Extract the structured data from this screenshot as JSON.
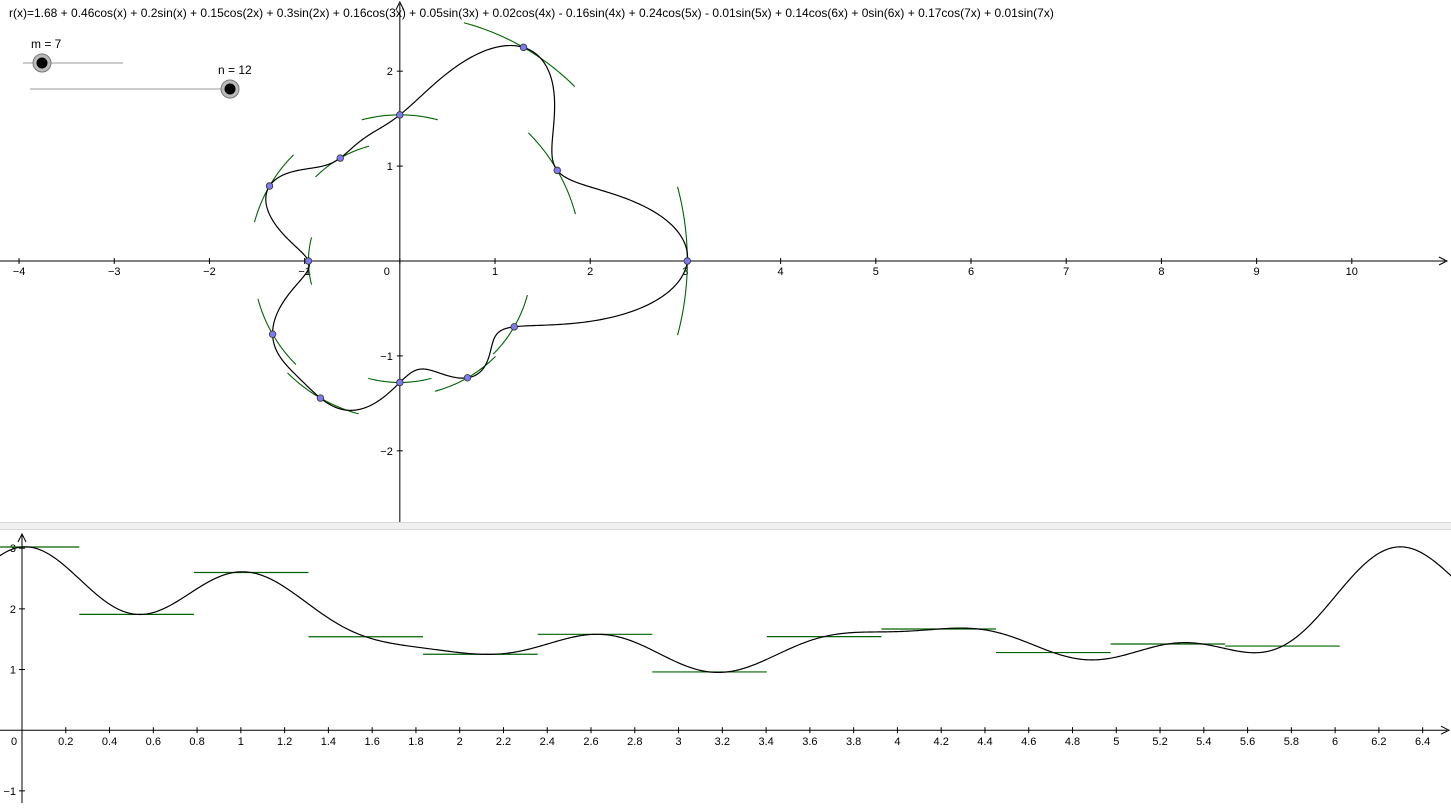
{
  "formula_text": "r(x)=1.68 + 0.46cos(x) + 0.2sin(x) + 0.15cos(2x) + 0.3sin(2x) + 0.16cos(3x) + 0.05sin(3x) + 0.02cos(4x) - 0.16sin(4x) + 0.24cos(5x) - 0.01sin(5x) + 0.14cos(6x) + 0sin(6x) + 0.17cos(7x) + 0.01sin(7x)",
  "coefficients": {
    "a0": 1.68,
    "cos": [
      0.46,
      0.15,
      0.16,
      0.02,
      0.24,
      0.14,
      0.17
    ],
    "sin": [
      0.2,
      0.3,
      0.05,
      -0.16,
      -0.01,
      0,
      0.01
    ]
  },
  "sliders": {
    "m": {
      "label": "m = 7",
      "value": 7,
      "min": 1,
      "max": 7
    },
    "n": {
      "label": "n = 12",
      "value": 12,
      "min": 1,
      "max": 12
    }
  },
  "colors": {
    "curve": "#000000",
    "segments": "#006400",
    "points": "#7c7cf0",
    "slider_knob": "#000000"
  },
  "chart_data": [
    {
      "type": "line",
      "title": "",
      "description_of_curve": "polar curve r(x)",
      "xlim": [
        -4.2,
        11
      ],
      "ylim": [
        -2.75,
        2.75
      ],
      "x_ticks": [
        "-4",
        "-3",
        "-2",
        "-1",
        "0",
        "1",
        "2",
        "3",
        "4",
        "5",
        "6",
        "7",
        "8",
        "9",
        "10"
      ],
      "y_ticks": [
        "2",
        "1",
        "-1",
        "-2"
      ],
      "grid": false,
      "points_n": 12
    },
    {
      "type": "line",
      "title": "",
      "xlim": [
        0,
        6.63
      ],
      "ylim": [
        -1.2,
        3.3
      ],
      "x_ticks": [
        "0",
        "0.2",
        "0.4",
        "0.6",
        "0.8",
        "1",
        "1.2",
        "1.4",
        "1.6",
        "1.8",
        "2",
        "2.2",
        "2.4",
        "2.6",
        "2.8",
        "3",
        "3.2",
        "3.4",
        "3.6",
        "3.8",
        "4",
        "4.2",
        "4.4",
        "4.6",
        "4.8",
        "5",
        "5.2",
        "5.4",
        "5.6",
        "5.8",
        "6",
        "6.2",
        "6.4"
      ],
      "y_ticks": [
        "3",
        "2",
        "1",
        "-1"
      ],
      "grid": false,
      "step_segments_n": 12
    }
  ]
}
